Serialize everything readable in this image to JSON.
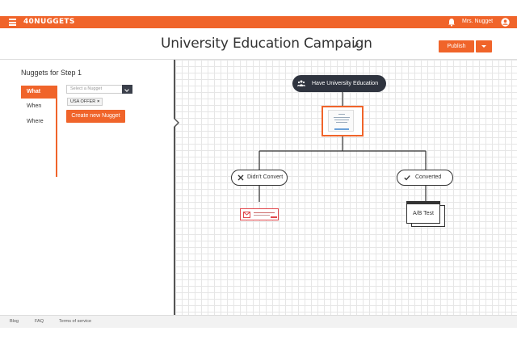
{
  "app": {
    "logo": "40NUGGETS",
    "user_name": "Mrs. Nugget",
    "accent": "#f0642a"
  },
  "header": {
    "title": "University Education Campaign",
    "publish_label": "Publish"
  },
  "left_panel": {
    "title": "Nuggets for Step 1",
    "tabs": [
      "What",
      "When",
      "Where"
    ],
    "select_placeholder": "Select a Nugget",
    "selected_tag": "USA OFFER",
    "tag_remove": "×",
    "create_label": "Create new Nugget"
  },
  "flow": {
    "root_label": "Have University Education",
    "branch_no": "Didn't Convert",
    "branch_yes": "Converted",
    "ab_test_label": "A/B Test"
  },
  "footer": {
    "links": [
      "Blog",
      "FAQ",
      "Terms of service"
    ]
  },
  "icons": {
    "menu": "hamburger-icon",
    "bell": "bell-icon",
    "avatar": "user-circle-icon",
    "edit": "pencil-icon",
    "group": "group-icon",
    "x": "close-icon",
    "check": "check-icon",
    "mail": "mail-icon"
  }
}
